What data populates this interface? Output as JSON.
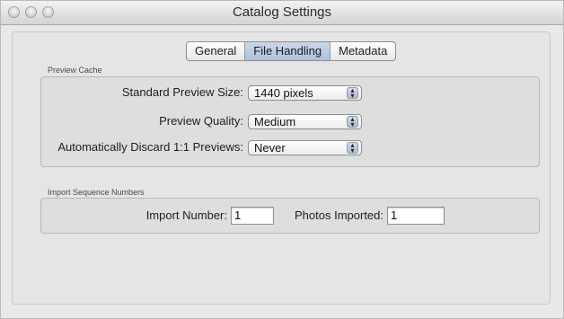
{
  "window": {
    "title": "Catalog Settings"
  },
  "tabs": [
    {
      "label": "General",
      "active": false
    },
    {
      "label": "File Handling",
      "active": true
    },
    {
      "label": "Metadata",
      "active": false
    }
  ],
  "preview_cache": {
    "group_label": "Preview Cache",
    "standard_preview_size": {
      "label": "Standard Preview Size:",
      "value": "1440 pixels"
    },
    "preview_quality": {
      "label": "Preview Quality:",
      "value": "Medium"
    },
    "discard_previews": {
      "label": "Automatically Discard 1:1 Previews:",
      "value": "Never"
    }
  },
  "import_sequence": {
    "group_label": "Import Sequence Numbers",
    "import_number": {
      "label": "Import Number:",
      "value": "1"
    },
    "photos_imported": {
      "label": "Photos Imported:",
      "value": "1"
    }
  },
  "colors": {
    "active_tab": "#b4c6df",
    "window_bg": "#e9e9e9"
  }
}
